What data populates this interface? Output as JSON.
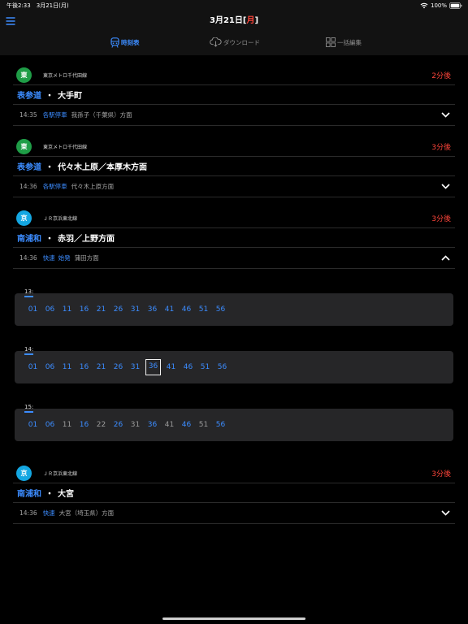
{
  "status_bar": {
    "time": "午後2:33",
    "date": "3月21日(月)",
    "battery": "100%"
  },
  "header": {
    "title_date": "3月21日",
    "title_open": "[",
    "title_day": "月",
    "title_close": "]"
  },
  "tabs": [
    {
      "label": "時刻表",
      "icon": "train-icon",
      "active": true
    },
    {
      "label": "ダウンロード",
      "icon": "cloud-download-icon",
      "active": false
    },
    {
      "label": "一括編集",
      "icon": "grid-icon",
      "active": false
    }
  ],
  "station_separator": "・",
  "cards": [
    {
      "badge": "東",
      "badge_color": "#1f9d47",
      "line": "東京メトロ千代田線",
      "eta": "2分後",
      "station": "表参道",
      "direction": "大手町",
      "time": "14:35",
      "train_type": "各駅停車",
      "destination": "我孫子（千葉県）方面",
      "expanded": false
    },
    {
      "badge": "東",
      "badge_color": "#1f9d47",
      "line": "東京メトロ千代田線",
      "eta": "3分後",
      "station": "表参道",
      "direction": "代々木上原／本厚木方面",
      "time": "14:36",
      "train_type": "各駅停車",
      "destination": "代々木上原方面",
      "expanded": false
    },
    {
      "badge": "京",
      "badge_color": "#14a7e2",
      "line": "ＪＲ京浜東北線",
      "eta": "3分後",
      "station": "南浦和",
      "direction": "赤羽／上野方面",
      "time": "14:36",
      "train_type": "快速",
      "note": "始発",
      "destination": "蒲田方面",
      "expanded": true,
      "timetable": [
        {
          "hour": "13:",
          "minutes": [
            {
              "m": "01"
            },
            {
              "m": "06"
            },
            {
              "m": "11"
            },
            {
              "m": "16"
            },
            {
              "m": "21"
            },
            {
              "m": "26"
            },
            {
              "m": "31"
            },
            {
              "m": "36"
            },
            {
              "m": "41"
            },
            {
              "m": "46"
            },
            {
              "m": "51"
            },
            {
              "m": "56"
            }
          ]
        },
        {
          "hour": "14:",
          "minutes": [
            {
              "m": "01"
            },
            {
              "m": "06"
            },
            {
              "m": "11"
            },
            {
              "m": "16"
            },
            {
              "m": "21"
            },
            {
              "m": "26"
            },
            {
              "m": "31"
            },
            {
              "m": "36",
              "selected": true
            },
            {
              "m": "41"
            },
            {
              "m": "46"
            },
            {
              "m": "51"
            },
            {
              "m": "56"
            }
          ]
        },
        {
          "hour": "15:",
          "minutes": [
            {
              "m": "01"
            },
            {
              "m": "06"
            },
            {
              "m": "11",
              "muted": true
            },
            {
              "m": "16"
            },
            {
              "m": "22",
              "muted": true
            },
            {
              "m": "26"
            },
            {
              "m": "31",
              "muted": true
            },
            {
              "m": "36"
            },
            {
              "m": "41",
              "muted": true
            },
            {
              "m": "46"
            },
            {
              "m": "51",
              "muted": true
            },
            {
              "m": "56"
            }
          ]
        }
      ]
    },
    {
      "badge": "京",
      "badge_color": "#14a7e2",
      "line": "ＪＲ京浜東北線",
      "eta": "3分後",
      "station": "南浦和",
      "direction": "大宮",
      "time": "14:36",
      "train_type": "快速",
      "destination": "大宮（埼玉県）方面",
      "expanded": false
    }
  ],
  "colors": {
    "accent": "#3c8cff",
    "eta": "#ff453a",
    "holiday": "#ff453a"
  }
}
